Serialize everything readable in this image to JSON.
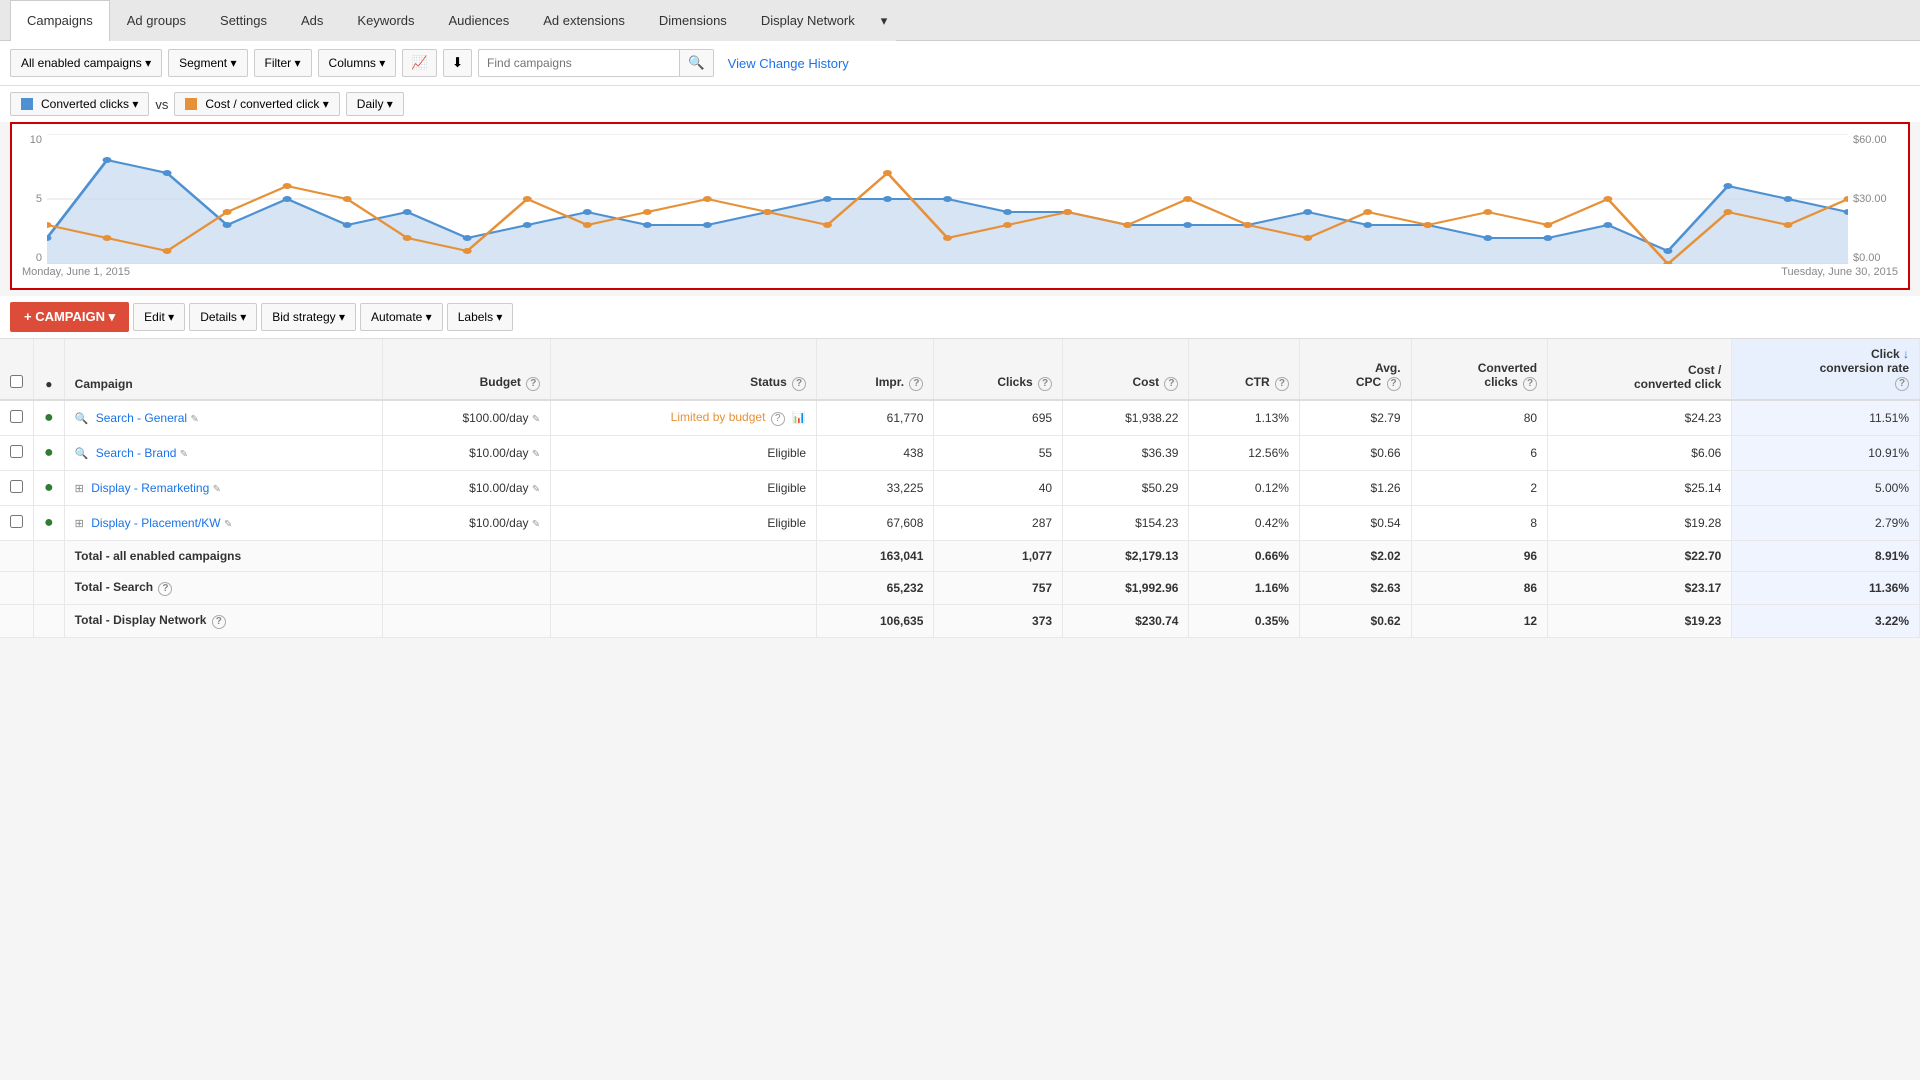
{
  "tabs": {
    "items": [
      {
        "label": "Campaigns",
        "active": true
      },
      {
        "label": "Ad groups",
        "active": false
      },
      {
        "label": "Settings",
        "active": false
      },
      {
        "label": "Ads",
        "active": false
      },
      {
        "label": "Keywords",
        "active": false
      },
      {
        "label": "Audiences",
        "active": false
      },
      {
        "label": "Ad extensions",
        "active": false
      },
      {
        "label": "Dimensions",
        "active": false
      },
      {
        "label": "Display Network",
        "active": false
      },
      {
        "label": "▾",
        "active": false
      }
    ]
  },
  "toolbar": {
    "all_campaigns_label": "All enabled campaigns ▾",
    "segment_label": "Segment ▾",
    "filter_label": "Filter ▾",
    "columns_label": "Columns ▾",
    "search_placeholder": "Find campaigns",
    "view_history_label": "View Change History"
  },
  "chart_controls": {
    "metric1_label": "Converted clicks ▾",
    "vs_label": "vs",
    "metric2_label": "Cost / converted click ▾",
    "period_label": "Daily ▾"
  },
  "chart": {
    "y_left_max": "10",
    "y_left_mid": "5",
    "y_left_min": "0",
    "y_right_max": "$60.00",
    "y_right_mid": "$30.00",
    "y_right_min": "$0.00",
    "date_start": "Monday, June 1, 2015",
    "date_end": "Tuesday, June 30, 2015"
  },
  "action_bar": {
    "add_campaign_label": "+ CAMPAIGN ▾",
    "edit_label": "Edit ▾",
    "details_label": "Details ▾",
    "bid_strategy_label": "Bid strategy ▾",
    "automate_label": "Automate ▾",
    "labels_label": "Labels ▾"
  },
  "table": {
    "headers": [
      {
        "key": "checkbox",
        "label": ""
      },
      {
        "key": "status_dot",
        "label": "●"
      },
      {
        "key": "campaign",
        "label": "Campaign"
      },
      {
        "key": "budget",
        "label": "Budget"
      },
      {
        "key": "status",
        "label": "Status"
      },
      {
        "key": "impr",
        "label": "Impr."
      },
      {
        "key": "clicks",
        "label": "Clicks"
      },
      {
        "key": "cost",
        "label": "Cost"
      },
      {
        "key": "ctr",
        "label": "CTR"
      },
      {
        "key": "avg_cpc",
        "label": "Avg. CPC"
      },
      {
        "key": "converted_clicks",
        "label": "Converted clicks"
      },
      {
        "key": "cost_converted",
        "label": "Cost / converted click"
      },
      {
        "key": "click_conversion_rate",
        "label": "Click conversion rate ↓"
      }
    ],
    "rows": [
      {
        "campaign": "Search - General",
        "campaign_type": "search",
        "budget": "$100.00/day",
        "status": "Limited by budget",
        "status_type": "limited",
        "impr": "61,770",
        "clicks": "695",
        "cost": "$1,938.22",
        "ctr": "1.13%",
        "avg_cpc": "$2.79",
        "converted_clicks": "80",
        "cost_converted": "$24.23",
        "click_conversion_rate": "11.51%"
      },
      {
        "campaign": "Search - Brand",
        "campaign_type": "search",
        "budget": "$10.00/day",
        "status": "Eligible",
        "status_type": "eligible",
        "impr": "438",
        "clicks": "55",
        "cost": "$36.39",
        "ctr": "12.56%",
        "avg_cpc": "$0.66",
        "converted_clicks": "6",
        "cost_converted": "$6.06",
        "click_conversion_rate": "10.91%"
      },
      {
        "campaign": "Display - Remarketing",
        "campaign_type": "display",
        "budget": "$10.00/day",
        "status": "Eligible",
        "status_type": "eligible",
        "impr": "33,225",
        "clicks": "40",
        "cost": "$50.29",
        "ctr": "0.12%",
        "avg_cpc": "$1.26",
        "converted_clicks": "2",
        "cost_converted": "$25.14",
        "click_conversion_rate": "5.00%"
      },
      {
        "campaign": "Display - Placement/KW",
        "campaign_type": "display",
        "budget": "$10.00/day",
        "status": "Eligible",
        "status_type": "eligible",
        "impr": "67,608",
        "clicks": "287",
        "cost": "$154.23",
        "ctr": "0.42%",
        "avg_cpc": "$0.54",
        "converted_clicks": "8",
        "cost_converted": "$19.28",
        "click_conversion_rate": "2.79%"
      }
    ],
    "totals": [
      {
        "label": "Total - all enabled campaigns",
        "impr": "163,041",
        "clicks": "1,077",
        "cost": "$2,179.13",
        "ctr": "0.66%",
        "avg_cpc": "$2.02",
        "converted_clicks": "96",
        "cost_converted": "$22.70",
        "click_conversion_rate": "8.91%"
      },
      {
        "label": "Total - Search",
        "impr": "65,232",
        "clicks": "757",
        "cost": "$1,992.96",
        "ctr": "1.16%",
        "avg_cpc": "$2.63",
        "converted_clicks": "86",
        "cost_converted": "$23.17",
        "click_conversion_rate": "11.36%"
      },
      {
        "label": "Total - Display Network",
        "impr": "106,635",
        "clicks": "373",
        "cost": "$230.74",
        "ctr": "0.35%",
        "avg_cpc": "$0.62",
        "converted_clicks": "12",
        "cost_converted": "$19.23",
        "click_conversion_rate": "3.22%"
      }
    ]
  }
}
